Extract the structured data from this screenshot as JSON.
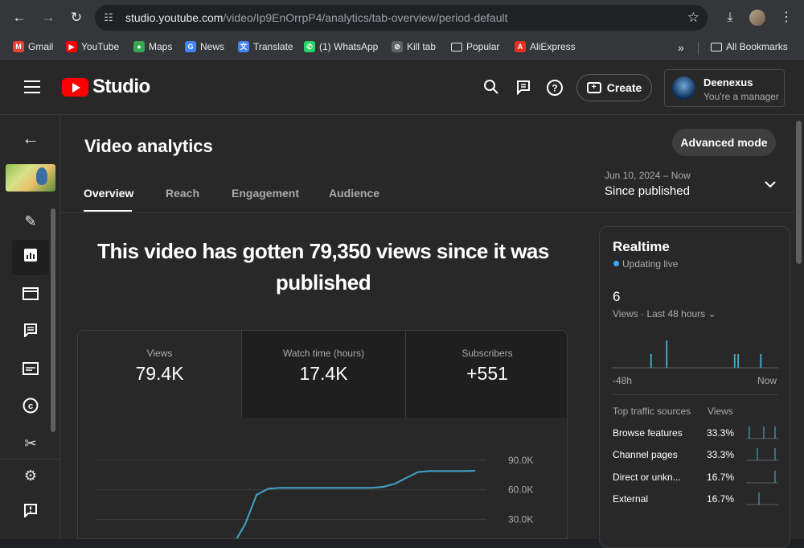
{
  "browser": {
    "url_host": "studio.youtube.com",
    "url_path": "/video/Ip9EnOrrpP4/analytics/tab-overview/period-default",
    "bookmarks": [
      {
        "label": "Gmail",
        "icon": "gmail-icon",
        "color": "#ea4335",
        "glyph": "M"
      },
      {
        "label": "YouTube",
        "icon": "youtube-icon",
        "color": "#ff0000",
        "glyph": "▶"
      },
      {
        "label": "Maps",
        "icon": "maps-icon",
        "color": "#34a853",
        "glyph": "●"
      },
      {
        "label": "News",
        "icon": "news-icon",
        "color": "#4285f4",
        "glyph": "G"
      },
      {
        "label": "Translate",
        "icon": "translate-icon",
        "color": "#4285f4",
        "glyph": "文"
      },
      {
        "label": "(1) WhatsApp",
        "icon": "whatsapp-icon",
        "color": "#25d366",
        "glyph": "✆"
      },
      {
        "label": "Kill tab",
        "icon": "kill-tab-icon",
        "color": "#5f6368",
        "glyph": "⊘"
      },
      {
        "label": "Popular",
        "icon": "folder-icon",
        "color": "transparent",
        "glyph": "▭"
      },
      {
        "label": "AliExpress",
        "icon": "aliexpress-icon",
        "color": "#e43225",
        "glyph": "A"
      }
    ],
    "overflow": "»",
    "all_bookmarks": "All Bookmarks"
  },
  "header": {
    "studio_word": "Studio",
    "create_label": "Create",
    "account_name": "Deenexus",
    "account_role": "You're a manager"
  },
  "page": {
    "title": "Video analytics",
    "advanced_mode": "Advanced mode",
    "tabs": [
      "Overview",
      "Reach",
      "Engagement",
      "Audience"
    ],
    "date_range": "Jun 10, 2024 – Now",
    "period": "Since published",
    "headline": "This video has gotten 79,350 views since it was published"
  },
  "metrics": [
    {
      "label": "Views",
      "value": "79.4K"
    },
    {
      "label": "Watch time (hours)",
      "value": "17.4K"
    },
    {
      "label": "Subscribers",
      "value": "+551"
    }
  ],
  "chart_data": {
    "type": "line",
    "series": [
      {
        "values": [
          0,
          0,
          0,
          0,
          0,
          0,
          0,
          0,
          0,
          0,
          0,
          0,
          5000,
          25000,
          55000,
          61000,
          62000,
          62000,
          62000,
          62000,
          62000,
          62000,
          62000,
          62000,
          62000,
          63000,
          66000,
          72000,
          78000,
          79000,
          79000,
          79000,
          79000,
          79350
        ]
      }
    ],
    "ylim": [
      0,
      90000
    ],
    "y_ticks": [
      "90.0K",
      "60.0K",
      "30.0K"
    ],
    "accent": "#41a5c8"
  },
  "realtime": {
    "title": "Realtime",
    "status": "Updating live",
    "count": "6",
    "window": "Views · Last 48 hours",
    "axis_left": "-48h",
    "axis_right": "Now",
    "spark_values": [
      0,
      0,
      0,
      0,
      0,
      0,
      0,
      0,
      0,
      0,
      0,
      0,
      0,
      0,
      0,
      0,
      0,
      0,
      0,
      0,
      0,
      0,
      1,
      0,
      0,
      0,
      0,
      0,
      0,
      0,
      0,
      2,
      0,
      0,
      0,
      0,
      0,
      0,
      0,
      0,
      0,
      0,
      0,
      0,
      0,
      0,
      0,
      0,
      0,
      0,
      0,
      0,
      0,
      0,
      0,
      0,
      0,
      0,
      0,
      0,
      0,
      0,
      0,
      0,
      0,
      0,
      0,
      0,
      0,
      0,
      1,
      0,
      1,
      0,
      0,
      0,
      0,
      0,
      0,
      0,
      0,
      0,
      0,
      0,
      0,
      1,
      0,
      0,
      0,
      0,
      0,
      0,
      0,
      0,
      0,
      0
    ],
    "traffic_header_source": "Top traffic sources",
    "traffic_header_views": "Views",
    "sources": [
      {
        "name": "Browse features",
        "pct": "33.3%"
      },
      {
        "name": "Channel pages",
        "pct": "33.3%"
      },
      {
        "name": "Direct or unkn...",
        "pct": "16.7%"
      },
      {
        "name": "External",
        "pct": "16.7%"
      }
    ]
  }
}
